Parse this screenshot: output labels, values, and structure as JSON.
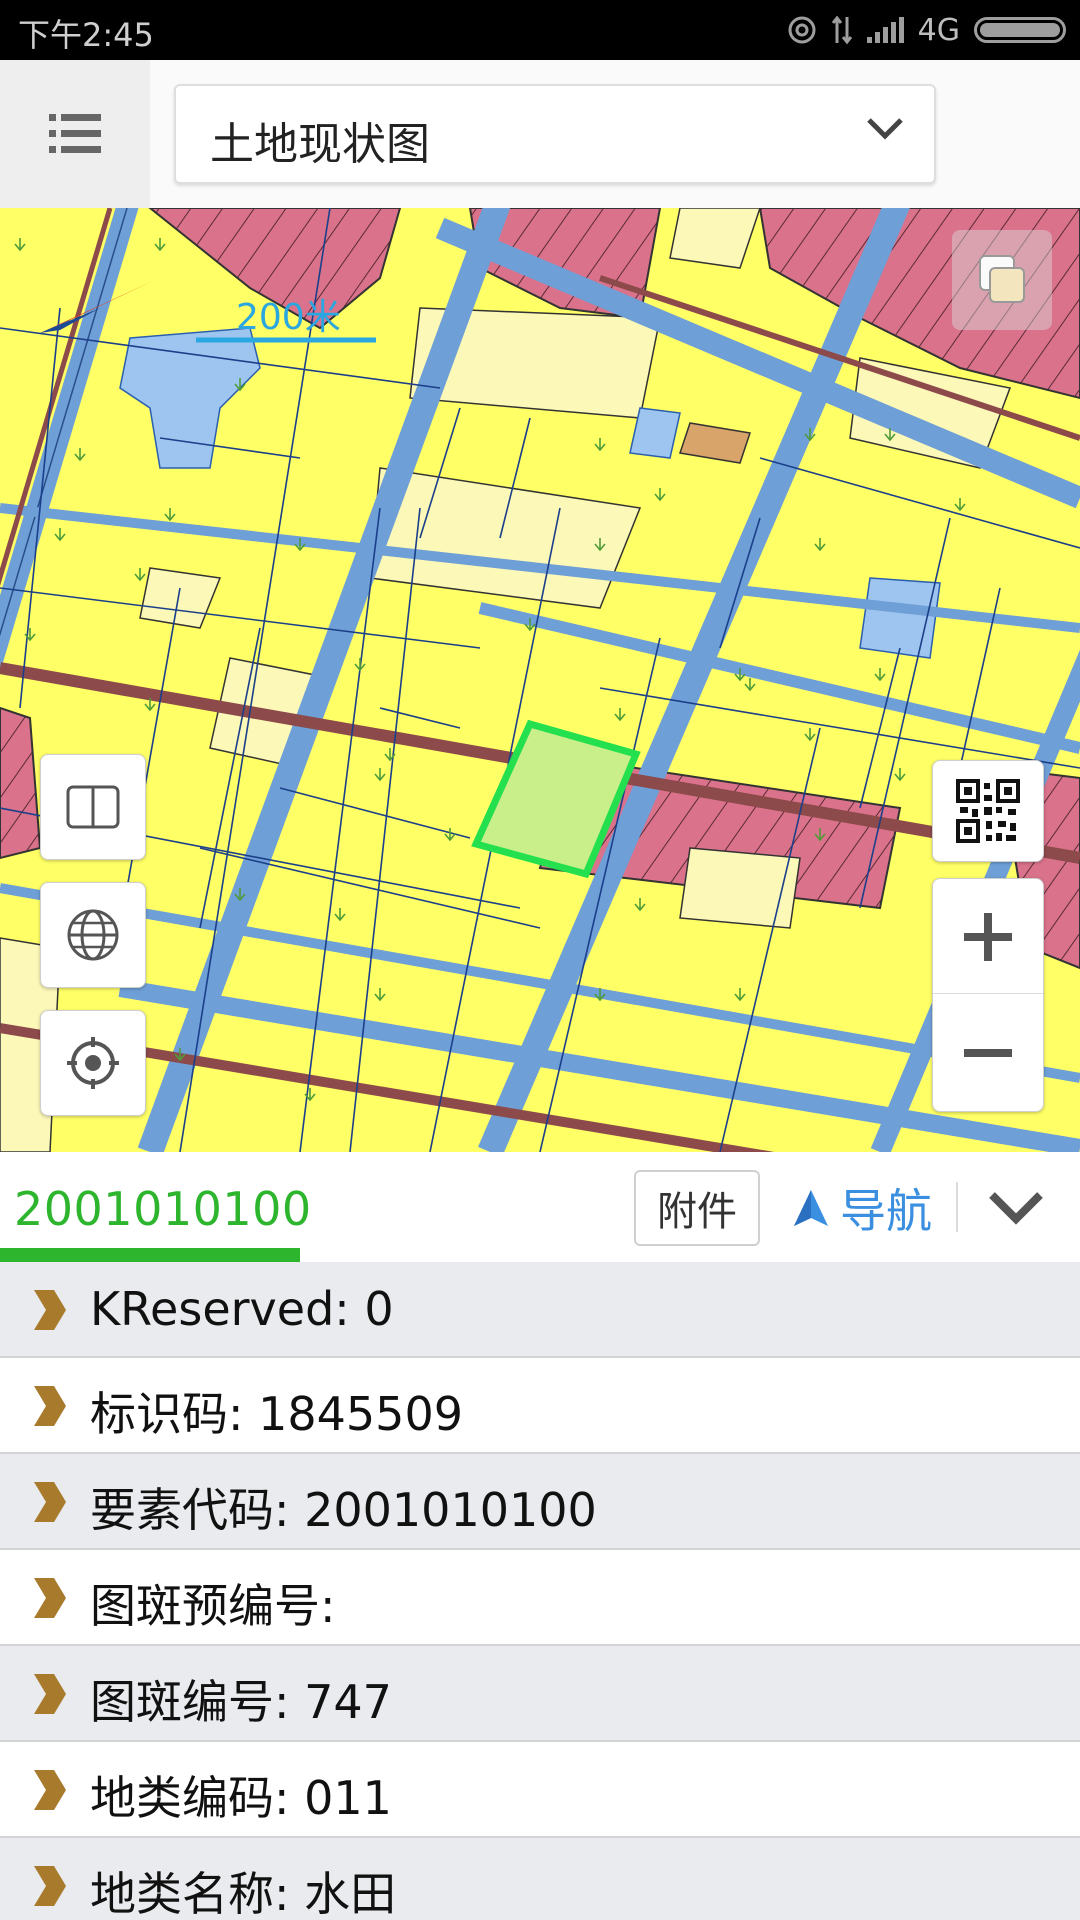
{
  "status_bar": {
    "time": "下午2:45",
    "network": "4G"
  },
  "toolbar": {
    "menu_icon": "list-menu-icon",
    "layer_select_value": "土地现状图"
  },
  "map": {
    "scale_label": "200米",
    "colors": {
      "farmland": "#ffff66",
      "construction": "#d9728a",
      "water": "#9ec5ef",
      "road": "#6e9fd6",
      "rail_road": "#8c4a4a",
      "rural_land": "#fcf8b8",
      "selection": "#24e04e",
      "selection_fill": "#c8ef8a"
    },
    "controls": {
      "layers_icon": "layers-icon",
      "book_icon": "book-icon",
      "globe_icon": "globe-icon",
      "locate_icon": "locate-icon",
      "qr_icon": "qr-code-icon",
      "zoom_in_icon": "plus-icon",
      "zoom_out_icon": "minus-icon"
    }
  },
  "feature_panel": {
    "tab_code": "2001010100",
    "attach_label": "附件",
    "nav_label": "导航",
    "accent_color": "#2db52d",
    "nav_color": "#3b8fe0",
    "attributes": [
      {
        "text": "KReserved: 0"
      },
      {
        "text": "标识码: 1845509"
      },
      {
        "text": "要素代码: 2001010100"
      },
      {
        "text": "图斑预编号:"
      },
      {
        "text": "图斑编号: 747"
      },
      {
        "text": "地类编码: 011"
      },
      {
        "text": "地类名称: 水田"
      }
    ]
  }
}
